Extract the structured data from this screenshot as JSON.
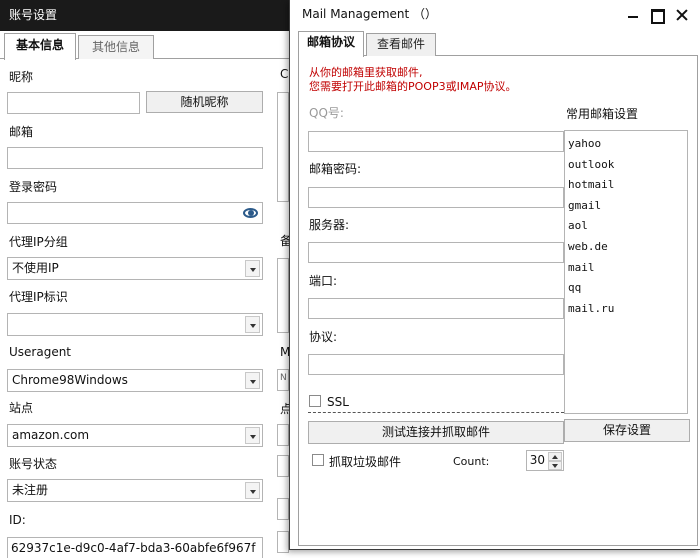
{
  "bg_window": {
    "title": "账号设置",
    "tabs": [
      {
        "label": "基本信息"
      },
      {
        "label": "其他信息"
      }
    ],
    "nickname_label": "昵称",
    "nickname_value": "",
    "random_nickname_button": "随机昵称",
    "email_label": "邮箱",
    "email_value": "",
    "password_label": "登录密码",
    "password_value": "",
    "proxy_group_label": "代理IP分组",
    "proxy_group_value": "不使用IP",
    "proxy_tag_label": "代理IP标识",
    "proxy_tag_value": "",
    "useragent_label": "Useragent",
    "useragent_value": "Chrome98Windows",
    "site_label": "站点",
    "site_value": "amazon.com",
    "status_label": "账号状态",
    "status_value": "未注册",
    "id_label": "ID:",
    "id_value": "62937c1e-d9c0-4af7-bda3-60abfe6f967f",
    "partial_labels": [
      "C",
      "备",
      "M",
      "N",
      "点"
    ]
  },
  "dialog": {
    "title": "Mail Management （）",
    "tabs": [
      {
        "label": "邮箱协议"
      },
      {
        "label": "查看邮件"
      }
    ],
    "note_line1": "从你的邮箱里获取邮件,",
    "note_line2": "您需要打开此邮箱的POOP3或IMAP协议。",
    "qq_label": "QQ号:",
    "qq_value": "",
    "mail_password_label": "邮箱密码:",
    "mail_password_value": "",
    "server_label": "服务器:",
    "server_value": "",
    "port_label": "端口:",
    "port_value": "",
    "protocol_label": "协议:",
    "protocol_value": "",
    "ssl_label": "SSL",
    "test_button": "测试连接并抓取邮件",
    "junk_label": "抓取垃圾邮件",
    "count_label": "Count:",
    "count_value": "30",
    "presets_header": "常用邮箱设置",
    "presets": [
      "yahoo",
      "outlook",
      "hotmail",
      "gmail",
      "aol",
      "web.de",
      "mail",
      "qq",
      "mail.ru"
    ],
    "save_button": "保存设置"
  }
}
